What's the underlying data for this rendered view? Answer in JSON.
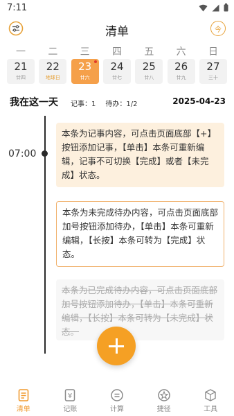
{
  "status_bar": {
    "time": "7:11"
  },
  "header": {
    "title": "清单",
    "today_label": "今"
  },
  "week": {
    "weekdays": [
      "一",
      "二",
      "三",
      "四",
      "五",
      "六",
      "日"
    ],
    "dates": [
      {
        "day": "21",
        "lunar": "廿四"
      },
      {
        "day": "22",
        "lunar": "地球日"
      },
      {
        "day": "23",
        "lunar": "廿六"
      },
      {
        "day": "24",
        "lunar": "廿七"
      },
      {
        "day": "25",
        "lunar": "廿八"
      },
      {
        "day": "26",
        "lunar": "廿九"
      },
      {
        "day": "27",
        "lunar": "三十"
      }
    ],
    "selected_index": 2
  },
  "summary": {
    "title": "我在这一天",
    "notes": "记事：1",
    "todos": "待办：1/2",
    "date": "2025-04-23"
  },
  "timeline": {
    "time": "07:00",
    "cards": {
      "note": "本条为记事内容，可点击页面底部【+】按钮添加记事，【单击】本条可重新编辑，记事不可切换【完成】或者【未完成】状态。",
      "todo": "本条为未完成待办内容，可点击页面底部加号按钮添加待办，【单击】本条可重新编辑，【长按】本条可转为【完成】状态。",
      "done": "本条为已完成待办内容，可点击页面底部加号按钮添加待办，【单击】本条可重新编辑，【长按】本条可转为【未完成】状态。"
    }
  },
  "nav": {
    "items": [
      "清单",
      "记账",
      "计算",
      "捷径",
      "工具"
    ],
    "active_index": 0
  },
  "colors": {
    "accent": "#f5a024",
    "note_bg": "#fdf0de",
    "todo_border": "#f0b06a",
    "date_dot": "#e23b2a"
  }
}
